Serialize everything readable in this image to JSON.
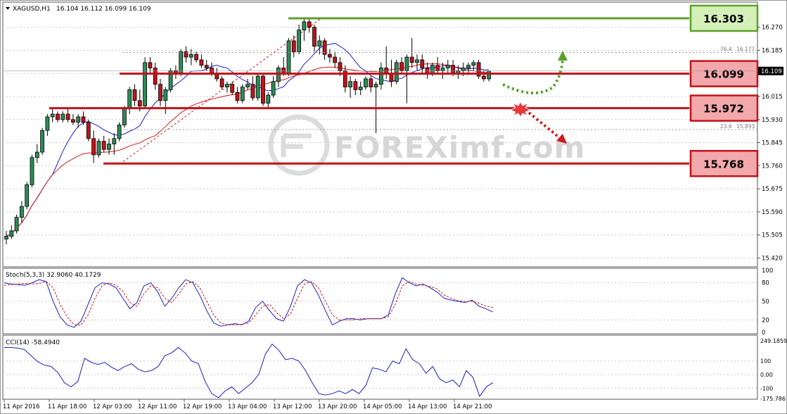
{
  "header": {
    "symbol": "XAGUSD,H1",
    "ohlc": "16.104 16.112 16.099 16.109"
  },
  "watermark": "FOREXimf.com",
  "chart_data": [
    {
      "type": "candlestick",
      "title": "XAGUSD,H1",
      "ylim": [
        15.39,
        16.36
      ],
      "yticks": [
        "16.270",
        "16.185",
        "16.100",
        "16.015",
        "15.930",
        "15.845",
        "15.760",
        "15.675",
        "15.590",
        "15.505",
        "15.420"
      ],
      "xticks": [
        "11 Apr 2016",
        "11 Apr 18:00",
        "12 Apr 03:00",
        "12 Apr 11:00",
        "12 Apr 19:00",
        "13 Apr 04:00",
        "13 Apr 12:00",
        "13 Apr 20:00",
        "14 Apr 05:00",
        "14 Apr 13:00",
        "14 Apr 21:00"
      ],
      "current_price": "16.109",
      "fib_labels": [
        "76.4",
        "16.177",
        "23.6",
        "15.893"
      ],
      "levels": [
        {
          "value": "16.303",
          "color": "#5ea02c",
          "box_fill": "#d4f0b8"
        },
        {
          "value": "16.099",
          "color": "#c0131a",
          "box_fill": "#f3a8ac"
        },
        {
          "value": "15.972",
          "color": "#c0131a",
          "box_fill": "#f3a8ac"
        },
        {
          "value": "15.768",
          "color": "#c0131a",
          "box_fill": "#f3a8ac"
        }
      ],
      "candles": [
        [
          15.49,
          15.52,
          15.47,
          15.5
        ],
        [
          15.5,
          15.54,
          15.49,
          15.52
        ],
        [
          15.52,
          15.58,
          15.51,
          15.57
        ],
        [
          15.57,
          15.63,
          15.55,
          15.61
        ],
        [
          15.61,
          15.7,
          15.6,
          15.69
        ],
        [
          15.69,
          15.8,
          15.68,
          15.79
        ],
        [
          15.79,
          15.84,
          15.77,
          15.81
        ],
        [
          15.81,
          15.9,
          15.8,
          15.89
        ],
        [
          15.89,
          15.95,
          15.87,
          15.94
        ],
        [
          15.94,
          15.97,
          15.92,
          15.95
        ],
        [
          15.95,
          15.96,
          15.92,
          15.93
        ],
        [
          15.93,
          15.96,
          15.92,
          15.95
        ],
        [
          15.95,
          15.97,
          15.92,
          15.93
        ],
        [
          15.93,
          15.95,
          15.91,
          15.92
        ],
        [
          15.92,
          15.95,
          15.9,
          15.94
        ],
        [
          15.94,
          15.96,
          15.91,
          15.92
        ],
        [
          15.92,
          15.93,
          15.85,
          15.86
        ],
        [
          15.86,
          15.89,
          15.77,
          15.8
        ],
        [
          15.8,
          15.86,
          15.79,
          15.85
        ],
        [
          15.85,
          15.87,
          15.81,
          15.82
        ],
        [
          15.82,
          15.86,
          15.8,
          15.84
        ],
        [
          15.84,
          15.88,
          15.8,
          15.86
        ],
        [
          15.86,
          15.92,
          15.85,
          15.91
        ],
        [
          15.91,
          15.98,
          15.9,
          15.97
        ],
        [
          15.97,
          16.05,
          15.95,
          16.04
        ],
        [
          16.04,
          16.06,
          15.98,
          16.0
        ],
        [
          16.0,
          16.04,
          15.96,
          15.98
        ],
        [
          15.98,
          16.16,
          15.97,
          16.14
        ],
        [
          16.14,
          16.16,
          16.1,
          16.12
        ],
        [
          16.12,
          16.14,
          16.04,
          16.06
        ],
        [
          16.06,
          16.08,
          15.98,
          16.0
        ],
        [
          16.0,
          16.05,
          15.95,
          16.04
        ],
        [
          16.04,
          16.12,
          16.03,
          16.11
        ],
        [
          16.11,
          16.13,
          16.08,
          16.1
        ],
        [
          16.1,
          16.19,
          16.09,
          16.18
        ],
        [
          16.18,
          16.2,
          16.14,
          16.16
        ],
        [
          16.16,
          16.19,
          16.13,
          16.17
        ],
        [
          16.17,
          16.18,
          16.14,
          16.15
        ],
        [
          16.15,
          16.17,
          16.12,
          16.13
        ],
        [
          16.13,
          16.15,
          16.11,
          16.12
        ],
        [
          16.12,
          16.14,
          16.09,
          16.1
        ],
        [
          16.1,
          16.12,
          16.07,
          16.08
        ],
        [
          16.08,
          16.09,
          16.04,
          16.05
        ],
        [
          16.05,
          16.07,
          16.03,
          16.06
        ],
        [
          16.06,
          16.07,
          16.02,
          16.03
        ],
        [
          16.03,
          16.05,
          15.99,
          16.0
        ],
        [
          16.0,
          16.06,
          15.99,
          16.05
        ],
        [
          16.05,
          16.08,
          16.04,
          16.06
        ],
        [
          16.06,
          16.09,
          16.0,
          16.01
        ],
        [
          16.01,
          16.1,
          16.0,
          16.09
        ],
        [
          16.09,
          16.1,
          15.98,
          15.99
        ],
        [
          15.99,
          16.03,
          15.97,
          16.02
        ],
        [
          16.02,
          16.09,
          16.01,
          16.07
        ],
        [
          16.07,
          16.13,
          16.05,
          16.12
        ],
        [
          16.12,
          16.16,
          16.09,
          16.1
        ],
        [
          16.1,
          16.23,
          16.09,
          16.22
        ],
        [
          16.22,
          16.24,
          16.16,
          16.18
        ],
        [
          16.18,
          16.28,
          16.17,
          16.26
        ],
        [
          16.26,
          16.3,
          16.22,
          16.29
        ],
        [
          16.29,
          16.3,
          16.25,
          16.27
        ],
        [
          16.27,
          16.28,
          16.18,
          16.2
        ],
        [
          16.2,
          16.24,
          16.17,
          16.22
        ],
        [
          16.22,
          16.23,
          16.15,
          16.17
        ],
        [
          16.17,
          16.19,
          16.14,
          16.16
        ],
        [
          16.16,
          16.18,
          16.12,
          16.14
        ],
        [
          16.14,
          16.16,
          16.09,
          16.11
        ],
        [
          16.11,
          16.13,
          16.03,
          16.05
        ],
        [
          16.05,
          16.09,
          16.01,
          16.07
        ],
        [
          16.07,
          16.08,
          16.02,
          16.04
        ],
        [
          16.04,
          16.07,
          16.02,
          16.05
        ],
        [
          16.05,
          16.09,
          16.04,
          16.08
        ],
        [
          16.08,
          16.09,
          16.03,
          16.05
        ],
        [
          16.05,
          16.07,
          15.88,
          16.06
        ],
        [
          16.06,
          16.14,
          16.04,
          16.12
        ],
        [
          16.12,
          16.2,
          16.08,
          16.1
        ],
        [
          16.1,
          16.15,
          16.05,
          16.07
        ],
        [
          16.07,
          16.15,
          16.06,
          16.14
        ],
        [
          16.14,
          16.16,
          16.1,
          16.11
        ],
        [
          16.11,
          16.17,
          15.99,
          16.16
        ],
        [
          16.16,
          16.23,
          16.12,
          16.14
        ],
        [
          16.14,
          16.17,
          16.11,
          16.15
        ],
        [
          16.15,
          16.17,
          16.1,
          16.12
        ],
        [
          16.12,
          16.14,
          16.08,
          16.1
        ],
        [
          16.1,
          16.14,
          16.09,
          16.13
        ],
        [
          16.13,
          16.16,
          16.1,
          16.11
        ],
        [
          16.11,
          16.14,
          16.08,
          16.12
        ],
        [
          16.12,
          16.15,
          16.1,
          16.13
        ],
        [
          16.13,
          16.15,
          16.09,
          16.1
        ],
        [
          16.1,
          16.13,
          16.08,
          16.11
        ],
        [
          16.11,
          16.14,
          16.09,
          16.12
        ],
        [
          16.12,
          16.14,
          16.1,
          16.13
        ],
        [
          16.13,
          16.15,
          16.11,
          16.14
        ],
        [
          16.14,
          16.15,
          16.08,
          16.09
        ],
        [
          16.09,
          16.11,
          16.07,
          16.08
        ],
        [
          16.08,
          16.11,
          16.07,
          16.109
        ]
      ]
    },
    {
      "type": "line",
      "title": "Stoch(5,3,3) 32.9060 40.1729",
      "ylim": [
        0,
        100
      ],
      "yticks": [
        "100",
        "80",
        "50",
        "20",
        "0"
      ],
      "series": [
        {
          "color": "#1c1ec8",
          "values": [
            80,
            78,
            77,
            76,
            80,
            85,
            82,
            50,
            25,
            12,
            8,
            18,
            45,
            72,
            80,
            78,
            72,
            55,
            38,
            48,
            75,
            80,
            65,
            42,
            55,
            72,
            85,
            80,
            60,
            35,
            15,
            10,
            12,
            14,
            12,
            18,
            40,
            50,
            35,
            22,
            18,
            42,
            75,
            85,
            80,
            60,
            35,
            12,
            18,
            22,
            22,
            20,
            22,
            22,
            22,
            28,
            62,
            88,
            80,
            75,
            78,
            72,
            65,
            55,
            52,
            50,
            48,
            52,
            42,
            38,
            32.9
          ]
        },
        {
          "color": "#d11919",
          "values": [
            76,
            77,
            78,
            79,
            78,
            79,
            82,
            72,
            45,
            25,
            12,
            12,
            28,
            55,
            75,
            80,
            76,
            66,
            48,
            42,
            62,
            75,
            72,
            55,
            48,
            62,
            78,
            82,
            72,
            50,
            28,
            15,
            12,
            12,
            13,
            15,
            28,
            42,
            45,
            32,
            22,
            30,
            55,
            78,
            82,
            72,
            50,
            28,
            20,
            20,
            20,
            22,
            22,
            22,
            22,
            25,
            45,
            75,
            82,
            78,
            76,
            74,
            70,
            60,
            55,
            51,
            50,
            50,
            47,
            42,
            40.2
          ]
        }
      ]
    },
    {
      "type": "line",
      "title": "CCI(14) -58.4940",
      "yticks": [
        "249.1859",
        "100",
        "0.00",
        "-100",
        "-175.786"
      ],
      "series": [
        {
          "color": "#1c1ec8",
          "values": [
            200,
            200,
            195,
            185,
            140,
            95,
            70,
            60,
            15,
            -60,
            -90,
            -50,
            120,
            90,
            75,
            90,
            55,
            30,
            60,
            80,
            40,
            20,
            30,
            60,
            140,
            160,
            200,
            160,
            100,
            80,
            -50,
            -140,
            -170,
            -120,
            -90,
            -140,
            -100,
            -60,
            0,
            150,
            225,
            180,
            110,
            120,
            100,
            30,
            -60,
            -140,
            -150,
            -140,
            -120,
            -140,
            -110,
            -140,
            -80,
            50,
            40,
            20,
            100,
            80,
            190,
            110,
            80,
            10,
            60,
            -30,
            -60,
            -40,
            -90,
            30,
            -20,
            -160,
            -90,
            -58.5
          ]
        }
      ]
    }
  ]
}
